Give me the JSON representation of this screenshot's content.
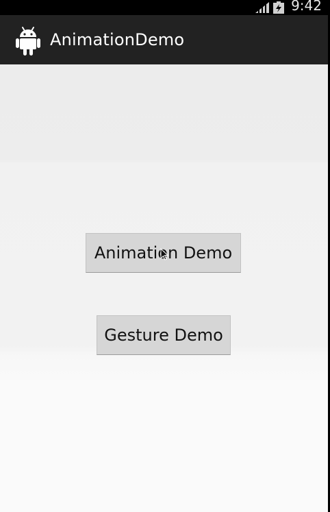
{
  "status_bar": {
    "time": "9:42",
    "icons": [
      "signal-icon",
      "battery-icon"
    ]
  },
  "action_bar": {
    "app_icon": "android-robot-icon",
    "title": "AnimationDemo"
  },
  "main": {
    "buttons": [
      {
        "label": "Animation Demo"
      },
      {
        "label": "Gesture Demo"
      }
    ]
  },
  "colors": {
    "status_bar_bg": "#000000",
    "action_bar_bg": "#222222",
    "content_bg": "#f2f2f2",
    "button_bg": "#d6d6d6",
    "title_text": "#ffffff"
  }
}
